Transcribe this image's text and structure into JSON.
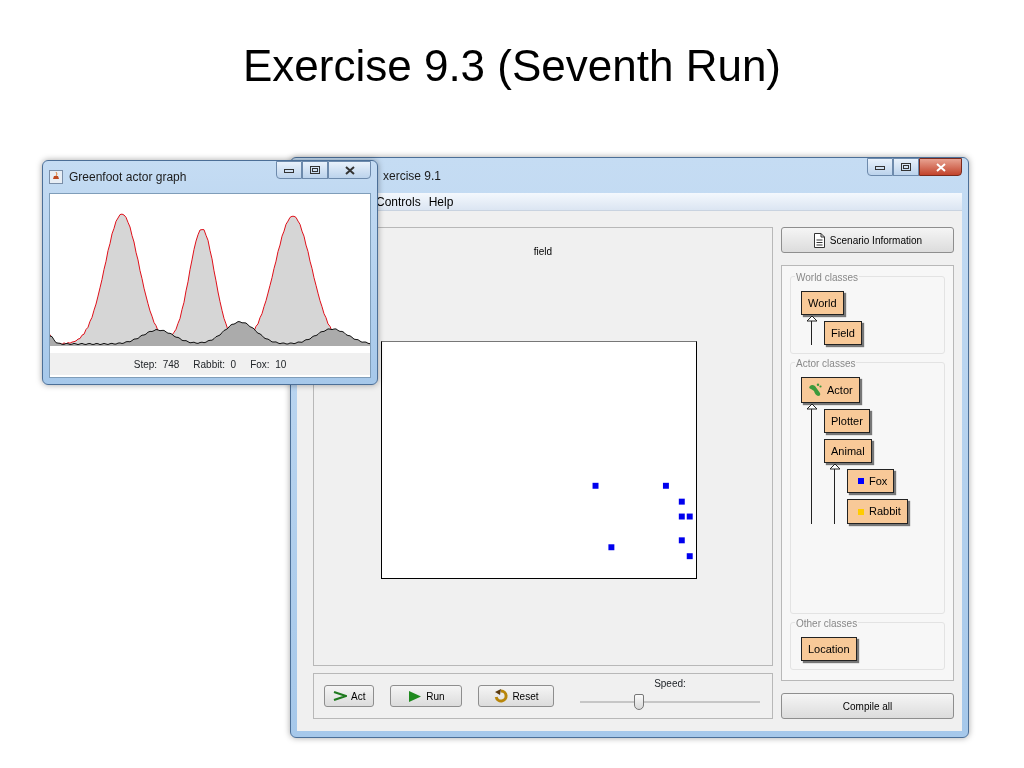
{
  "slide_title": "Exercise 9.3 (Seventh Run)",
  "graph_window": {
    "title": "Greenfoot actor graph",
    "status": [
      "Step:  748",
      "Rabbit:  0",
      "Fox:  10"
    ]
  },
  "main_window": {
    "title": "xercise 9.1",
    "menu": [
      "Controls",
      "Help"
    ]
  },
  "world": {
    "title": "field"
  },
  "controls": {
    "buttons": [
      {
        "label": "Act",
        "kind": "act"
      },
      {
        "label": "Run",
        "kind": "run"
      },
      {
        "label": "Reset",
        "kind": "reset"
      }
    ],
    "speed_label": "Speed:",
    "speed": {
      "level": 0.33
    }
  },
  "scenario_button": "Scenario Information",
  "class_groups": [
    {
      "title": "World classes",
      "classes": [
        {
          "name": "World",
          "children": [
            {
              "name": "Field"
            }
          ]
        }
      ]
    },
    {
      "title": "Actor classes",
      "classes": [
        {
          "name": "Actor",
          "kind": "footprint",
          "children": [
            {
              "name": "Plotter"
            },
            {
              "name": "Animal",
              "children": [
                {
                  "name": "Fox",
                  "kind": "swatch",
                  "color": "#0000ff"
                },
                {
                  "name": "Rabbit",
                  "kind": "swatch",
                  "color": "#ffcc00"
                }
              ]
            }
          ]
        }
      ]
    },
    {
      "title": "Other classes",
      "classes": [
        {
          "name": "Location"
        }
      ]
    }
  ],
  "compile_button": "Compile all"
}
